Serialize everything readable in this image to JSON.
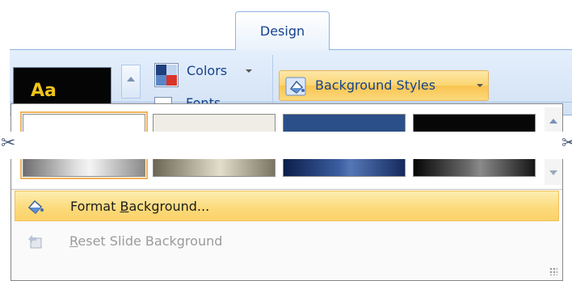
{
  "ribbon": {
    "tab_label": "Design",
    "theme_preview_text": "Aa",
    "colors_label": "Colors",
    "fonts_label": "Fonts",
    "background_styles_label": "Background Styles"
  },
  "gallery": {
    "swatches": [
      {
        "name": "white",
        "top": "#ffffff",
        "bottom_gradient": "linear-gradient(90deg,#6e6e6e,#e4e4e4 45%,#f4f4f4 55%,#8a8a8a)",
        "selected": true
      },
      {
        "name": "beige",
        "top": "#efede5",
        "bottom_gradient": "linear-gradient(90deg,#6b6655,#cfc9b6 45%,#e2ddcc 55%,#7a7462)",
        "selected": false
      },
      {
        "name": "navy",
        "top": "#2b4f88",
        "bottom_gradient": "linear-gradient(90deg,#0c1f4a,#3a5c9e 45%,#5577b6 55%,#142a5e)",
        "selected": false
      },
      {
        "name": "black",
        "top": "#070707",
        "bottom_gradient": "linear-gradient(90deg,#050505,#6b6b6b 45%,#8a8a8a 55%,#151515)",
        "selected": false
      }
    ]
  },
  "menu": {
    "format_background": {
      "pre": "Format ",
      "accel": "B",
      "post": "ackground..."
    },
    "reset_slide_background": {
      "pre": "",
      "accel": "R",
      "post": "eset Slide Background"
    }
  },
  "icons": {
    "scissors": "scissors-icon",
    "paint_bucket": "paint-bucket-icon",
    "reset": "reset-icon"
  },
  "colors": {
    "accent_orange": "#fbd26a",
    "ribbon_text": "#15428b",
    "disabled_text": "#9b9b9b"
  }
}
